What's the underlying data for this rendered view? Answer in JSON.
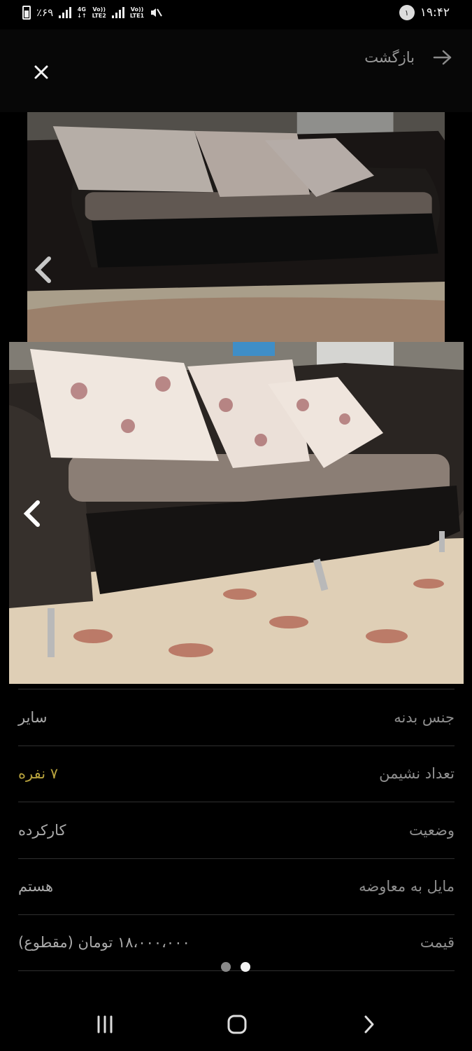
{
  "status_bar": {
    "battery": "٪۶۹",
    "net1": [
      "4G",
      "↓↑"
    ],
    "net2": [
      "Vo))",
      "LTE2"
    ],
    "net3": [
      "Vo))",
      "LTE1"
    ],
    "mute_icon": "muted-speaker-icon",
    "time": "۱۹:۴۲",
    "notification_count": "۱"
  },
  "header": {
    "back_label": "بازگشت",
    "close_icon": "close-icon",
    "back_icon": "arrow-right-icon"
  },
  "gallery": {
    "prev_icon": "chevron-left-icon",
    "images": [
      "sofa-photo-1",
      "sofa-photo-2"
    ],
    "active_index": 1
  },
  "specs": [
    {
      "label": "جنس بدنه",
      "value": "سایر"
    },
    {
      "label": "تعداد نشیمن",
      "value": "۷ نفره"
    },
    {
      "label": "وضعیت",
      "value": "کارکرده"
    },
    {
      "label": "مایل به معاوضه",
      "value": "هستم"
    },
    {
      "label": "قیمت",
      "value": "۱۸،۰۰۰،۰۰۰ تومان (مقطوع)"
    }
  ],
  "colors": {
    "background": "#000000",
    "accent": "#b7a23d",
    "label": "#8f8f8f",
    "value": "#aaaaaa"
  },
  "nav": {
    "recent_icon": "recent-apps-icon",
    "home_icon": "home-icon",
    "back_icon": "back-icon"
  }
}
